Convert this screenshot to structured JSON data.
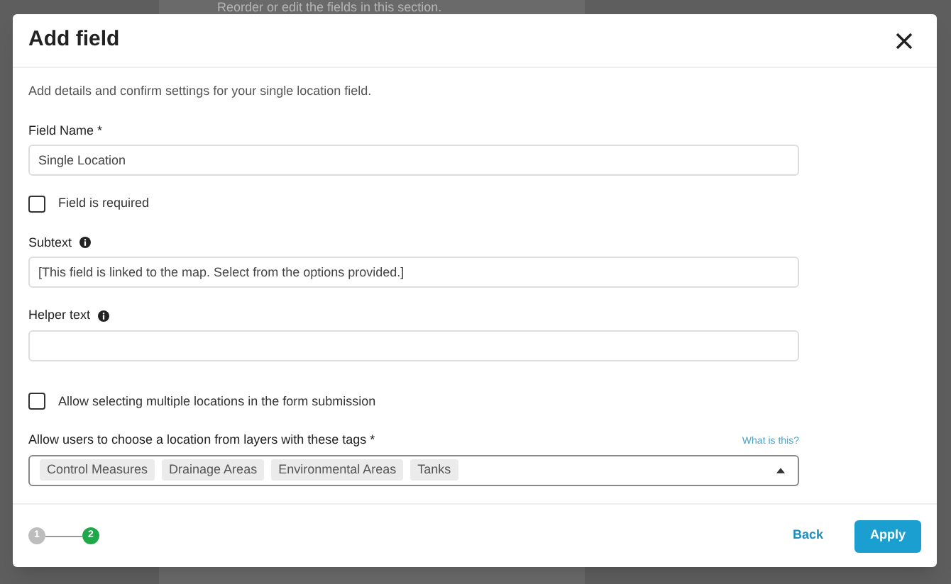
{
  "background": {
    "text": "Reorder or edit the fields in this section."
  },
  "dialog": {
    "title": "Add field",
    "description": "Add details and confirm settings for your single location field.",
    "fields": [
      {
        "kind": "input",
        "label": "Field Name *",
        "value": "Single Location",
        "info": false
      },
      {
        "kind": "checkbox",
        "label": "Field is required",
        "checked": false
      },
      {
        "kind": "input",
        "label": "Subtext",
        "value": "[This field is linked to the map. Select from the options provided.]",
        "info": true
      },
      {
        "kind": "input",
        "label": "Helper text",
        "info": true
      },
      {
        "kind": "checkbox",
        "label": "Allow selecting multiple locations in the form submission",
        "checked": false
      },
      {
        "kind": "tags",
        "label": "Allow users to choose a location from layers with these tags *",
        "link": "What is this?",
        "tags": [
          "Control Measures",
          "Drainage Areas",
          "Environmental Areas",
          "Tanks"
        ],
        "expanded": true
      }
    ],
    "steps": [
      {
        "label": "1",
        "selected": false
      },
      {
        "label": "2",
        "selected": true
      }
    ],
    "buttons": [
      {
        "kind": "text",
        "label": "Back"
      },
      {
        "kind": "primary",
        "label": "Apply"
      }
    ]
  }
}
